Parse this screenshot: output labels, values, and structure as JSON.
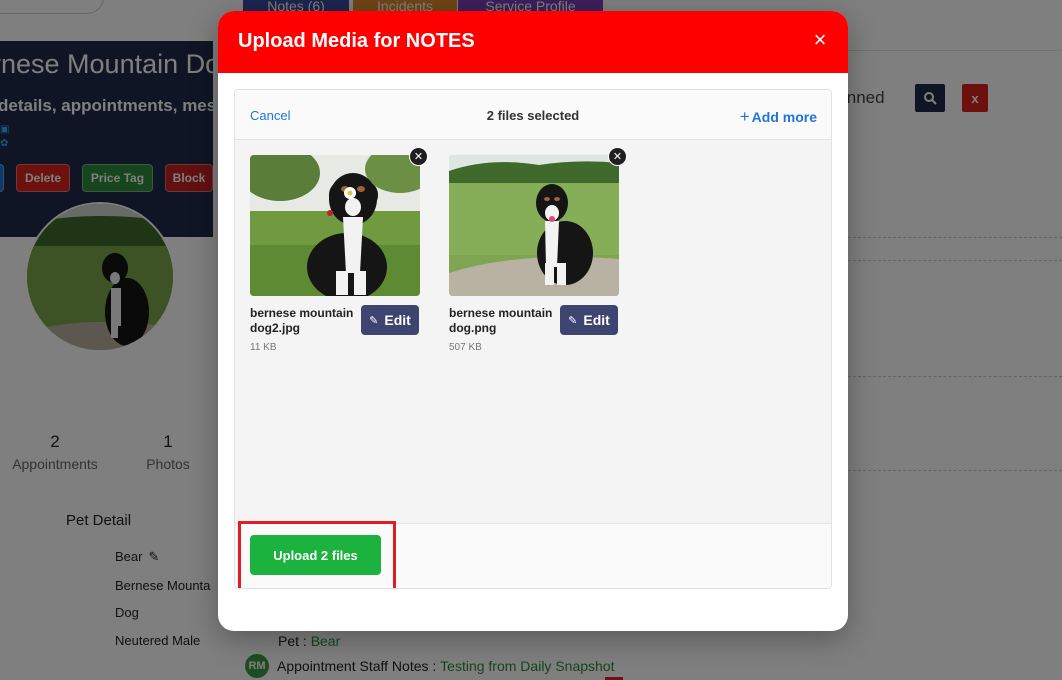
{
  "background": {
    "profile": {
      "name": "rnese Mountain Dog",
      "subtitle": "details, appointments, messa",
      "actions": [
        "Delete",
        "Price Tag",
        "Block"
      ]
    },
    "stats": [
      {
        "value": "2",
        "label": "Appointments"
      },
      {
        "value": "1",
        "label": "Photos"
      }
    ],
    "pet_detail": {
      "title": "Pet Detail",
      "name": "Bear",
      "breed": "Bernese Mounta",
      "species": "Dog",
      "sex": "Neutered Male"
    },
    "tabs": [
      "Notes (6)",
      "Incidents",
      "Service Profile"
    ],
    "pinned_label": "inned",
    "close_label": "x",
    "note": {
      "pet_label": "Pet :",
      "pet_value": "Bear",
      "badge": "RM",
      "staff_label": "Appointment Staff Notes :",
      "staff_value": "Testing from Daily Snapshot"
    }
  },
  "modal": {
    "title": "Upload Media for NOTES",
    "close_icon": "×",
    "toolbar": {
      "cancel": "Cancel",
      "selected": "2 files selected",
      "add_more": "Add more"
    },
    "files": [
      {
        "name": "bernese mountain dog2.jpg",
        "size": "11 KB",
        "edit": "Edit"
      },
      {
        "name": "bernese mountain dog.png",
        "size": "507 KB",
        "edit": "Edit"
      }
    ],
    "upload_label": "Upload 2 files"
  },
  "colors": {
    "header_red": "#ff0000",
    "upload_green": "#1bb33e",
    "link_blue": "#2275d7",
    "edit_navy": "#3e4470",
    "highlight_red": "#e31b23"
  }
}
